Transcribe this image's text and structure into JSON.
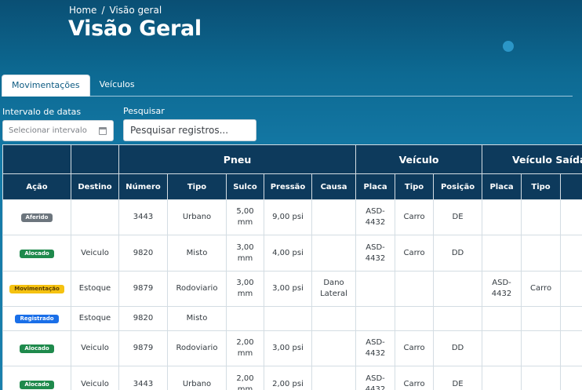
{
  "breadcrumb": {
    "home": "Home",
    "separator": "/",
    "current": "Visão geral"
  },
  "page": {
    "title": "Visão Geral"
  },
  "tabs": [
    {
      "label": "Movimentações",
      "active": true
    },
    {
      "label": "Veículos",
      "active": false
    }
  ],
  "filters": {
    "date_label": "Intervalo de datas",
    "date_placeholder": "Selecionar intervalo",
    "search_label": "Pesquisar",
    "search_placeholder": "Pesquisar registros..."
  },
  "table": {
    "groups": {
      "pneu": "Pneu",
      "veiculo": "Veículo",
      "veiculo_saida": "Veículo Saída"
    },
    "columns": {
      "acao": "Ação",
      "destino": "Destino",
      "numero": "Número",
      "tipo": "Tipo",
      "sulco": "Sulco",
      "pressao": "Pressão",
      "causa": "Causa",
      "placa": "Placa",
      "veic_tipo": "Tipo",
      "posicao": "Posição",
      "s_placa": "Placa",
      "s_tipo": "Tipo"
    },
    "rows": [
      {
        "acao": "Aferido",
        "badge_color": "gray",
        "destino": "",
        "numero": "3443",
        "tipo": "Urbano",
        "sulco": "5,00 mm",
        "pressao": "9,00 psi",
        "causa": "",
        "placa": "ASD-4432",
        "veic_tipo": "Carro",
        "posicao": "DE",
        "s_placa": "",
        "s_tipo": ""
      },
      {
        "acao": "Alocado",
        "badge_color": "green",
        "destino": "Veiculo",
        "numero": "9820",
        "tipo": "Misto",
        "sulco": "3,00 mm",
        "pressao": "4,00 psi",
        "causa": "",
        "placa": "ASD-4432",
        "veic_tipo": "Carro",
        "posicao": "DD",
        "s_placa": "",
        "s_tipo": ""
      },
      {
        "acao": "Movimentação",
        "badge_color": "yellow",
        "destino": "Estoque",
        "numero": "9879",
        "tipo": "Rodoviario",
        "sulco": "3,00 mm",
        "pressao": "3,00 psi",
        "causa": "Dano Lateral",
        "placa": "",
        "veic_tipo": "",
        "posicao": "",
        "s_placa": "ASD-4432",
        "s_tipo": "Carro"
      },
      {
        "acao": "Registrado",
        "badge_color": "blue",
        "destino": "Estoque",
        "numero": "9820",
        "tipo": "Misto",
        "sulco": "",
        "pressao": "",
        "causa": "",
        "placa": "",
        "veic_tipo": "",
        "posicao": "",
        "s_placa": "",
        "s_tipo": ""
      },
      {
        "acao": "Alocado",
        "badge_color": "green",
        "destino": "Veiculo",
        "numero": "9879",
        "tipo": "Rodoviario",
        "sulco": "2,00 mm",
        "pressao": "3,00 psi",
        "causa": "",
        "placa": "ASD-4432",
        "veic_tipo": "Carro",
        "posicao": "DD",
        "s_placa": "",
        "s_tipo": ""
      },
      {
        "acao": "Alocado",
        "badge_color": "green",
        "destino": "Veiculo",
        "numero": "3443",
        "tipo": "Urbano",
        "sulco": "2,00 mm",
        "pressao": "2,00 psi",
        "causa": "",
        "placa": "ASD-4432",
        "veic_tipo": "Carro",
        "posicao": "DE",
        "s_placa": "",
        "s_tipo": ""
      }
    ]
  }
}
